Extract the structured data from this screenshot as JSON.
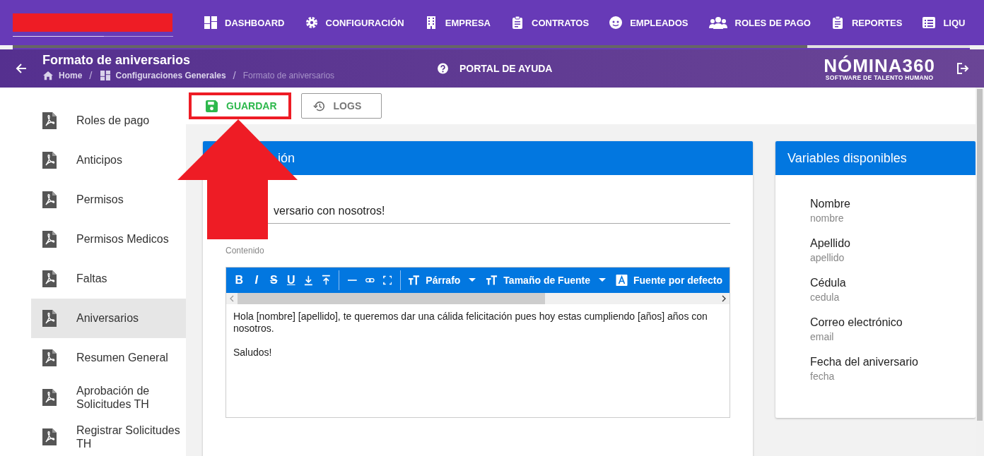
{
  "nav": {
    "items": [
      {
        "label": "DASHBOARD",
        "kind": "dashboard"
      },
      {
        "label": "CONFIGURACIÓN",
        "kind": "gear"
      },
      {
        "label": "EMPRESA",
        "kind": "building"
      },
      {
        "label": "CONTRATOS",
        "kind": "clipboard"
      },
      {
        "label": "EMPLEADOS",
        "kind": "face"
      },
      {
        "label": "ROLES DE PAGO",
        "kind": "people"
      },
      {
        "label": "REPORTES",
        "kind": "clipboard"
      },
      {
        "label": "LIQU",
        "kind": "list"
      }
    ],
    "progress": {
      "level": 0.83
    }
  },
  "header": {
    "title": "Formato de aniversarios",
    "breadcrumb": {
      "separator": "/",
      "items": [
        {
          "label": "Home",
          "kind": "home",
          "current": false
        },
        {
          "label": "Configuraciones Generales",
          "kind": "grid",
          "current": false
        },
        {
          "label": "Formato de aniversarios",
          "kind": "none",
          "current": true
        }
      ]
    },
    "help": "PORTAL DE AYUDA",
    "logo": {
      "name": "NÓMINA360",
      "tagline": "SOFTWARE DE TALENTO HUMANO"
    }
  },
  "sidebar": {
    "items": [
      {
        "label": "Roles de pago",
        "selected": false
      },
      {
        "label": "Anticipos",
        "selected": false
      },
      {
        "label": "Permisos",
        "selected": false
      },
      {
        "label": "Permisos Medicos",
        "selected": false
      },
      {
        "label": "Faltas",
        "selected": false
      },
      {
        "label": "Aniversarios",
        "selected": true
      },
      {
        "label": "Resumen General",
        "selected": false
      },
      {
        "label": "Aprobación de Solicitudes TH",
        "selected": false
      },
      {
        "label": "Registrar Solicitudes TH",
        "selected": false
      }
    ]
  },
  "toolbar": {
    "save": "GUARDAR",
    "logs": "LOGS"
  },
  "form_card": {
    "title": "ión",
    "subject": "versario con nosotros!",
    "content_label": "Contenido",
    "editor": {
      "format_buttons": [
        {
          "label": "B",
          "kind": "bold"
        },
        {
          "label": "I",
          "kind": "italic"
        },
        {
          "label": "S",
          "kind": "strike"
        },
        {
          "label": "U",
          "kind": "underline"
        }
      ],
      "icon_buttons": [
        {
          "kind": "subscript"
        },
        {
          "kind": "superscript"
        },
        {
          "kind": "sep"
        },
        {
          "kind": "rule"
        },
        {
          "kind": "link"
        },
        {
          "kind": "fullscreen"
        },
        {
          "kind": "sep"
        }
      ],
      "dropdowns": [
        {
          "label": "Párrafo",
          "kind": "text-size"
        },
        {
          "label": "Tamaño de Fuente",
          "kind": "text-size"
        },
        {
          "label": "Fuente por defecto",
          "kind": "font"
        }
      ],
      "paragraphs": [
        "Hola [nombre] [apellido], te queremos dar una cálida felicitación pues hoy estas cumpliendo [años] años con nosotros.",
        "Saludos!"
      ]
    }
  },
  "variables_card": {
    "title": "Variables disponibles",
    "items": [
      {
        "label": "Nombre",
        "value": "nombre"
      },
      {
        "label": "Apellido",
        "value": "apellido"
      },
      {
        "label": "Cédula",
        "value": "cedula"
      },
      {
        "label": "Correo electrónico",
        "value": "email"
      },
      {
        "label": "Fecha del aniversario",
        "value": "fecha"
      }
    ]
  }
}
